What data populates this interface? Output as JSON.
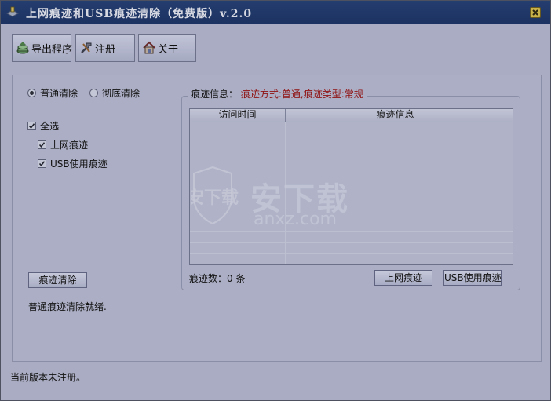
{
  "window": {
    "title": "上网痕迹和USB痕迹清除（免费版）v.2.0"
  },
  "toolbar": {
    "export_label": "导出程序",
    "register_label": "注册",
    "about_label": "关于"
  },
  "mode": {
    "normal_label": "普通清除",
    "thorough_label": "彻底清除",
    "selected": "普通清除"
  },
  "options": {
    "select_all_label": "全选",
    "internet_label": "上网痕迹",
    "usb_label": "USB使用痕迹",
    "select_all_checked": true,
    "internet_checked": true,
    "usb_checked": true
  },
  "actions": {
    "clear_label": "痕迹清除",
    "status": "普通痕迹清除就绪."
  },
  "trace_panel": {
    "title": "痕迹信息：",
    "detail": "痕迹方式:普通,痕迹类型:常规",
    "columns": [
      "访问时间",
      "痕迹信息"
    ],
    "count_label": "痕迹数：0 条",
    "internet_btn_label": "上网痕迹",
    "usb_btn_label": "USB使用痕迹"
  },
  "watermark": {
    "brand": "安下载",
    "domain": "anxz.com"
  },
  "footer": {
    "status": "当前版本未注册。"
  },
  "colors": {
    "title_bar": "#1f3666",
    "panel_bg": "#abaec4",
    "red_text": "#8f1010"
  }
}
